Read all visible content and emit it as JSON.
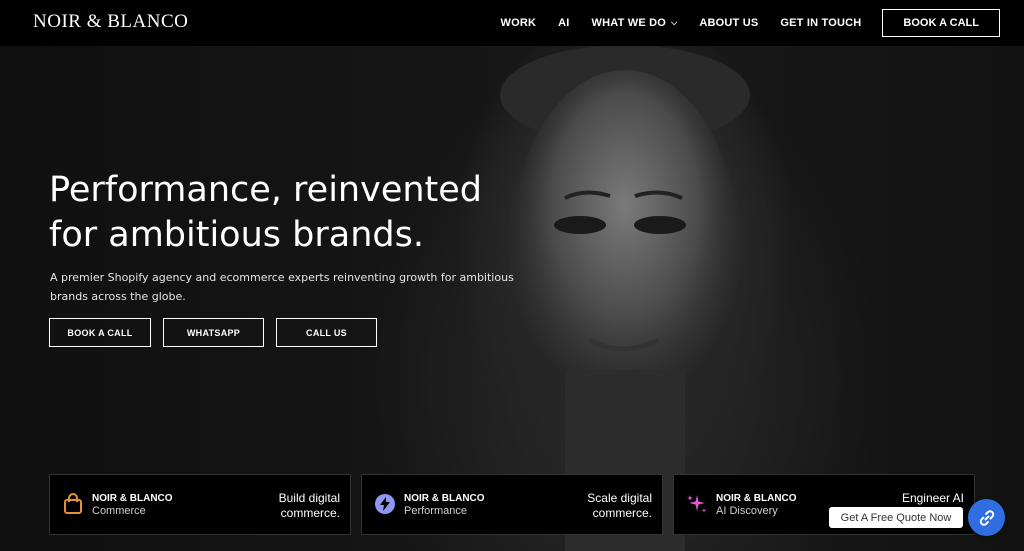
{
  "header": {
    "logo": "NOIR & BLANCO",
    "nav": [
      {
        "label": "WORK"
      },
      {
        "label": "AI"
      },
      {
        "label": "WHAT WE DO"
      },
      {
        "label": "ABOUT US"
      },
      {
        "label": "GET IN TOUCH"
      }
    ],
    "cta_label": "BOOK A CALL"
  },
  "hero": {
    "headline_line1": "Performance, reinvented",
    "headline_line2": "for ambitious brands.",
    "subtext": "A premier Shopify agency and ecommerce experts reinventing growth for ambitious brands across the globe.",
    "buttons": [
      {
        "label": "BOOK A CALL"
      },
      {
        "label": "WHATSAPP"
      },
      {
        "label": "CALL US"
      }
    ]
  },
  "cards": [
    {
      "brand": "NOIR & BLANCO",
      "sub": "Commerce",
      "desc": "Build digital commerce.",
      "icon": "shopping-bag-icon",
      "icon_color": "#e8902f"
    },
    {
      "brand": "NOIR & BLANCO",
      "sub": "Performance",
      "desc": "Scale digital commerce.",
      "icon": "bolt-icon",
      "icon_color": "#8e97f2"
    },
    {
      "brand": "NOIR & BLANCO",
      "sub": "AI Discovery",
      "desc": "Engineer AI",
      "icon": "sparkles-icon",
      "icon_color": "#e25ad0"
    }
  ],
  "floating": {
    "quote_label": "Get A Free Quote Now",
    "fab_icon": "link-icon",
    "fab_color": "#2f6de0"
  }
}
